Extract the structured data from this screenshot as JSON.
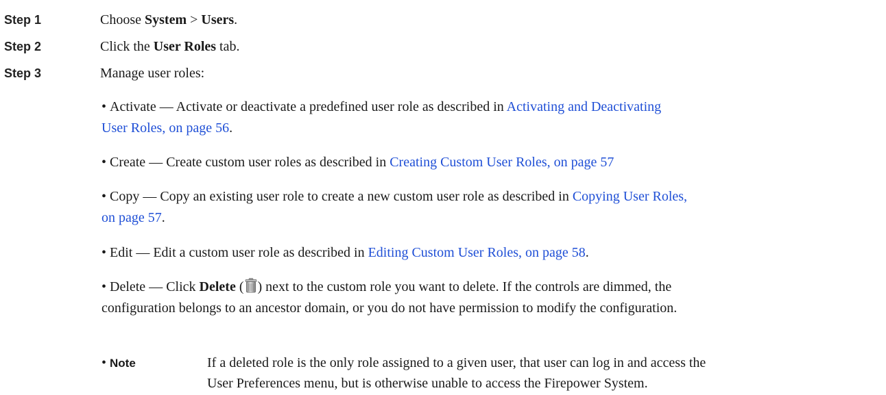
{
  "steps": [
    {
      "label": "Step 1",
      "text_pre": "Choose ",
      "bold1": "System",
      "sep": " > ",
      "bold2": "Users",
      "text_post": "."
    },
    {
      "label": "Step 2",
      "text_pre": "Click the ",
      "bold": "User Roles",
      "text_post": " tab."
    },
    {
      "label": "Step 3",
      "text": "Manage user roles:"
    }
  ],
  "bullets": {
    "activate": {
      "prefix": "Activate — Activate or deactivate a predefined user role as described in ",
      "link_line1": "Activating and Deactivating",
      "link_line2": "User Roles, on page 56",
      "suffix": "."
    },
    "create": {
      "prefix": "Create — Create custom user roles as described in ",
      "link": "Creating Custom User Roles, on page 57"
    },
    "copy": {
      "prefix": "Copy — Copy an existing user role to create a new custom user role as described in ",
      "link_line1": "Copying User Roles,",
      "link_line2": "on page 57",
      "suffix": "."
    },
    "edit": {
      "prefix": "Edit — Edit a custom user role as described in ",
      "link": "Editing Custom User Roles, on page 58",
      "suffix": "."
    },
    "delete": {
      "prefix": "Delete — Click ",
      "bold": "Delete",
      "paren_open": " (",
      "icon": "trash-icon",
      "paren_close": ")",
      "line1_rest": " next to the custom role you want to delete. If the controls are dimmed, the",
      "line2": "configuration belongs to an ancestor domain, or you do not have permission to modify the configuration."
    },
    "note": {
      "label": "Note",
      "line1": "If a deleted role is the only role assigned to a given user, that user can log in and access the",
      "line2": "User Preferences menu, but is otherwise unable to access the Firepower System."
    }
  },
  "colors": {
    "link": "#1f4fd6",
    "text": "#1a1a1a"
  }
}
